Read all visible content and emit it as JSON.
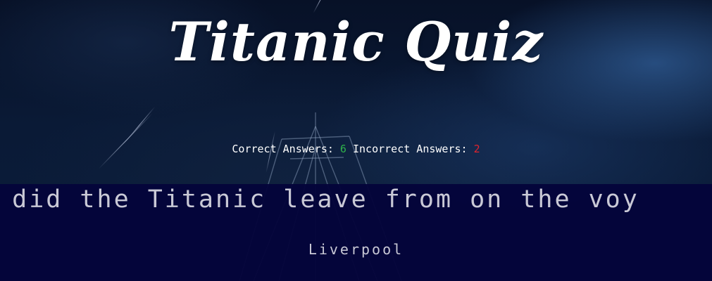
{
  "header": {
    "title": "Titanic Quiz"
  },
  "score": {
    "correct_label": "Correct Answers:",
    "correct_count": "6",
    "incorrect_label": "Incorrect Answers:",
    "incorrect_count": "2",
    "correct_color": "#2fb34b",
    "incorrect_color": "#e0232d"
  },
  "quiz": {
    "question": "e did the Titanic leave from on the voy",
    "answers": [
      "Liverpool"
    ],
    "band_color": "#04043a"
  }
}
